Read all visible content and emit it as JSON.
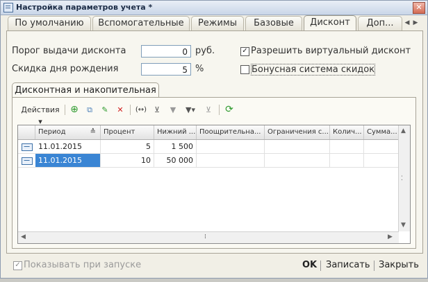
{
  "window": {
    "title": "Настройка параметров учета *"
  },
  "tabs": {
    "items": [
      {
        "label": "По умолчанию"
      },
      {
        "label": "Вспомогательные"
      },
      {
        "label": "Режимы"
      },
      {
        "label": "Базовые"
      },
      {
        "label": "Дисконт"
      },
      {
        "label": "Доп..."
      }
    ],
    "active": "Дисконт"
  },
  "discount": {
    "threshold_label": "Порог выдачи дисконта",
    "threshold_value": "0",
    "threshold_unit": "руб.",
    "birthday_label": "Скидка дня рождения",
    "birthday_value": "5",
    "birthday_unit": "%",
    "virtual_label": "Разрешить виртуальный дисконт",
    "virtual_checked": true,
    "bonus_label": "Бонусная система скидок",
    "bonus_checked": false
  },
  "subtab": {
    "label": "Дисконтная и накопительная"
  },
  "toolbar": {
    "actions_label": "Действия"
  },
  "table": {
    "columns": [
      "Период",
      "Процент",
      "Нижний ...",
      "Поощрительна...",
      "Ограничения с...",
      "Колич...",
      "Сумма..."
    ],
    "rows": [
      {
        "period": "11.01.2015",
        "percent": "5",
        "lower": "1 500",
        "selected": false
      },
      {
        "period": "11.01.2015",
        "percent": "10",
        "lower": "50 000",
        "selected": true
      }
    ]
  },
  "footer": {
    "show_on_start_label": "Показывать при запуске",
    "show_on_start_checked": true,
    "ok_label": "OK",
    "save_label": "Записать",
    "close_label": "Закрыть"
  },
  "colors": {
    "selection": "#3a85d4",
    "tab_bg": "#f7f6ef"
  }
}
